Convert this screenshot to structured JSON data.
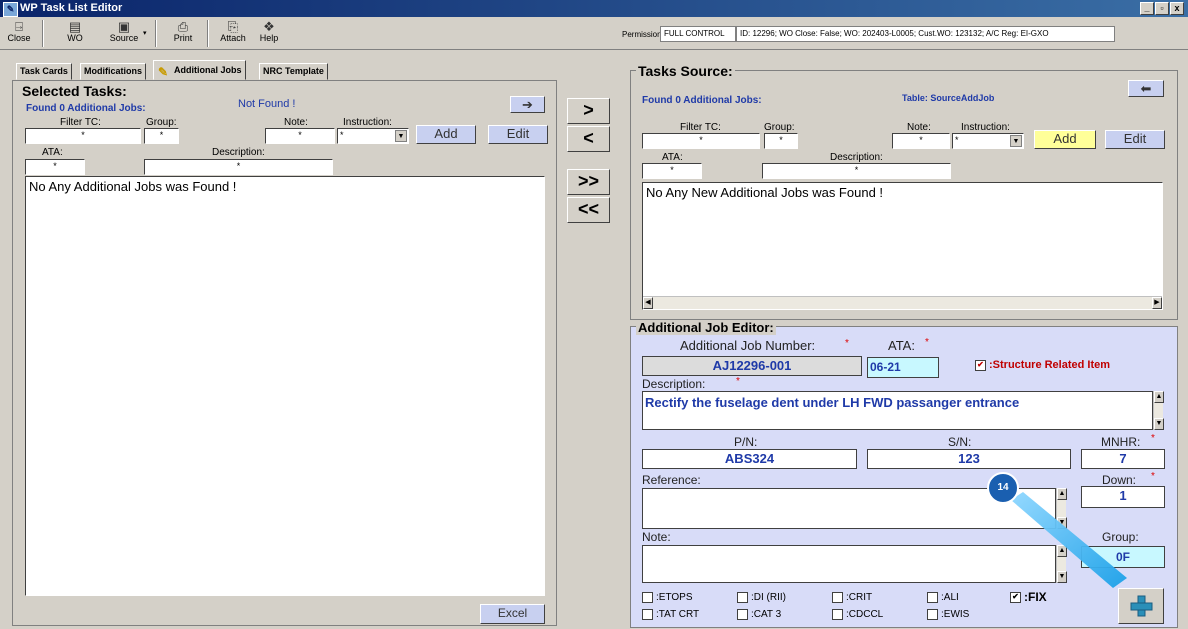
{
  "window": {
    "title": "WP Task List Editor",
    "buttons": [
      "_",
      "▫",
      "x"
    ]
  },
  "toolbar": {
    "items": [
      {
        "label": "Close",
        "icon": "door-icon"
      },
      {
        "label": "WO",
        "icon": "document-icon"
      },
      {
        "label": "Source",
        "icon": "source-icon"
      },
      {
        "label": "Print",
        "icon": "printer-icon"
      },
      {
        "label": "Attach",
        "icon": "attach-icon"
      },
      {
        "label": "Help",
        "icon": "help-icon"
      }
    ],
    "permission_label": "Permission:",
    "permission_value": "FULL CONTROL",
    "info": "ID: 12296; WO Close: False; WO: 202403-L0005; Cust.WO: 123132; A/C Reg: EI-GXO"
  },
  "tabs": [
    "Task Cards",
    "Modifications",
    "Additional Jobs",
    "NRC Template"
  ],
  "selected": {
    "title": "Selected Tasks:",
    "found": "Found 0 Additional Jobs:",
    "status": "Not Found !",
    "filter_tc_label": "Filter TC:",
    "group_label": "Group:",
    "note_label": "Note:",
    "instruction_label": "Instruction:",
    "ata_label": "ATA:",
    "description_label": "Description:",
    "star": "*",
    "add": "Add",
    "edit": "Edit",
    "list_text": "No Any Additional Jobs was Found !",
    "excel": "Excel"
  },
  "transfer": {
    "move_one_right": ">",
    "move_one_left": "<",
    "move_all_right": ">>",
    "move_all_left": "<<"
  },
  "source": {
    "title": "Tasks Source:",
    "found": "Found 0 Additional Jobs:",
    "table": "Table: SourceAddJob",
    "filter_tc_label": "Filter TC:",
    "group_label": "Group:",
    "note_label": "Note:",
    "instruction_label": "Instruction:",
    "ata_label": "ATA:",
    "description_label": "Description:",
    "star": "*",
    "add": "Add",
    "edit": "Edit",
    "list_text": "No Any New Additional Jobs was Found !"
  },
  "editor": {
    "title": "Additional Job Editor:",
    "job_number_label": "Additional Job Number:",
    "job_number": "AJ12296-001",
    "ata_label": "ATA:",
    "ata": "06-21",
    "structure_label": ":Structure Related Item",
    "description_label": "Description:",
    "description": "Rectify the fuselage dent under LH FWD passanger entrance",
    "pn_label": "P/N:",
    "pn": "ABS324",
    "sn_label": "S/N:",
    "sn": "123",
    "mnhr_label": "MNHR:",
    "mnhr": "7",
    "reference_label": "Reference:",
    "down_label": "Down:",
    "down": "1",
    "note_label": "Note:",
    "group_label": "Group:",
    "group": "0F",
    "req_star": "*",
    "checkboxes": [
      {
        "label": ":ETOPS",
        "checked": false
      },
      {
        "label": ":DI (RII)",
        "checked": false
      },
      {
        "label": ":CRIT",
        "checked": false
      },
      {
        "label": ":ALI",
        "checked": false
      },
      {
        "label": ":FIX",
        "checked": true
      },
      {
        "label": ":TAT CRT",
        "checked": false
      },
      {
        "label": ":CAT 3",
        "checked": false
      },
      {
        "label": ":CDCCL",
        "checked": false
      },
      {
        "label": ":EWIS",
        "checked": false
      }
    ]
  },
  "callout": {
    "number": "14"
  }
}
